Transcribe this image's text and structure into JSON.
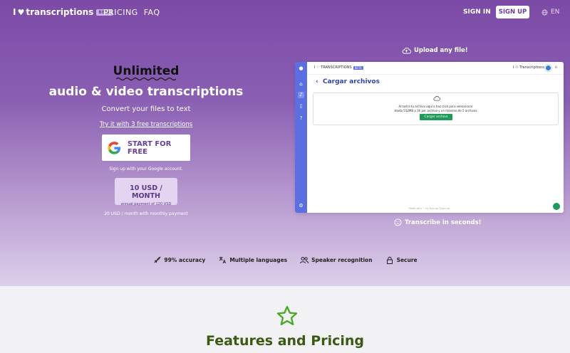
{
  "header": {
    "logo_i": "I",
    "logo_text": "transcriptions",
    "beta": "BETA",
    "nav": [
      "PRICING",
      "FAQ"
    ],
    "signin": "SIGN IN",
    "signup": "SIGN UP",
    "lang": "EN"
  },
  "hero": {
    "unlimited": "Unlimited",
    "title": "audio & video transcriptions",
    "subtitle": "Convert your files to text",
    "try_link": "Try it with 3 free transcriptions",
    "start_button": "START FOR FREE",
    "signup_note": "Sign up with your Google account.",
    "price_main": "10 USD / MONTH",
    "price_sub": "annual payment of 120 USD",
    "monthly_note": "20 USD / month with monthly payment"
  },
  "demo": {
    "upload_label": "Upload any file!",
    "logo_text": "I ♡ TRANSCRIPTIONS",
    "beta": "BETA",
    "credits": "I ☉ Transcriptions",
    "lang": "H",
    "title": "Cargar archivos",
    "drop_line1": "Arrastra tu archivo aquí o haz click para seleccionar",
    "drop_line2": "Hasta 512MB o 3h por archivo y un máximo de 5 archivos",
    "upload_button": "Cargar archivo",
    "footer": "Made with ♡ by Konrad Tyszcrub",
    "transcribe_label": "Transcribe in seconds!"
  },
  "features": [
    {
      "label": "99% accuracy",
      "icon": "rocket-icon"
    },
    {
      "label": "Multiple languages",
      "icon": "translate-icon"
    },
    {
      "label": "Speaker recognition",
      "icon": "people-icon"
    },
    {
      "label": "Secure",
      "icon": "lock-icon"
    }
  ],
  "section": {
    "title": "Features and Pricing",
    "icon": "star-icon"
  },
  "colors": {
    "brand_purple": "#7b4aa6",
    "accent_green": "#3a5a14",
    "demo_blue": "#5b6fe3"
  }
}
